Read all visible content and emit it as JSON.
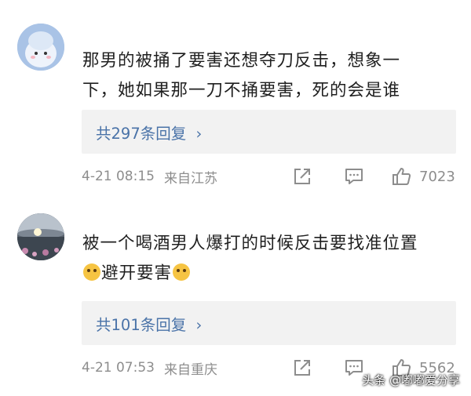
{
  "comments": [
    {
      "text_lines": [
        "那男的被捅了要害还想夺刀反击，想象一",
        "下，她如果那一刀不捅要害，死的会是谁"
      ],
      "replies_label": "共297条回复",
      "time": "4-21 08:15",
      "location": "来自江苏",
      "likes": "7023"
    },
    {
      "text_lines": [
        "被一个喝酒男人爆打的时候反击要找准位置",
        "避开要害"
      ],
      "replies_label": "共101条回复",
      "time": "4-21 07:53",
      "location": "来自重庆",
      "likes": "5562"
    }
  ],
  "watermark": "头条 @嘟嘟爱分享",
  "icons": {
    "reply_chevron": "›",
    "share": "share-icon",
    "comment": "comment-icon",
    "like": "thumbs-up-icon",
    "emoji": "thinking-face-emoji"
  },
  "colors": {
    "link_blue": "#4a73a8",
    "meta_gray": "#8d8d8d",
    "reply_bg": "#f2f2f2"
  }
}
